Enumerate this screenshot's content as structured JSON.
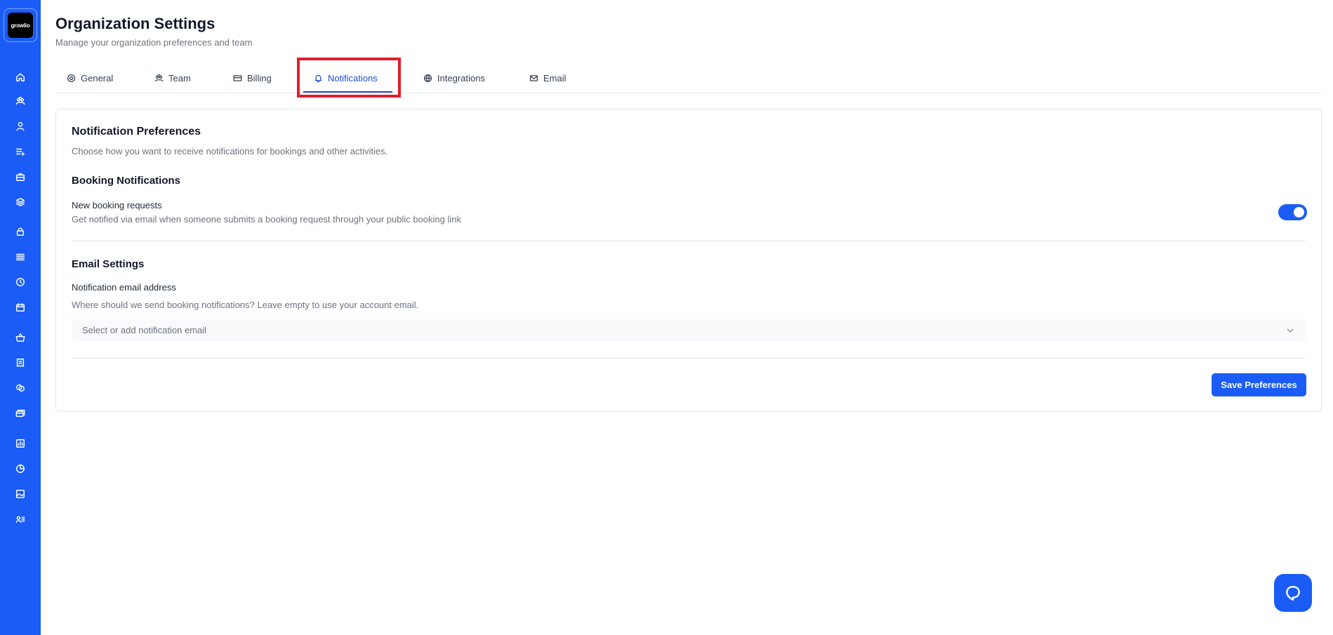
{
  "brand": {
    "logo_text": "growlio",
    "accent": "#1a5cf5",
    "highlight": "#e11d2e"
  },
  "sidebar": {
    "items": [
      {
        "icon": "home-icon"
      },
      {
        "icon": "team-icon"
      },
      {
        "icon": "user-icon"
      },
      {
        "icon": "list-add-icon"
      },
      {
        "icon": "briefcase-icon"
      },
      {
        "icon": "layers-icon"
      },
      {
        "icon": "lock-icon"
      },
      {
        "icon": "menu-lines-icon"
      },
      {
        "icon": "clock-icon"
      },
      {
        "icon": "calendar-icon"
      },
      {
        "icon": "basket-icon"
      },
      {
        "icon": "receipt-icon"
      },
      {
        "icon": "coins-icon"
      },
      {
        "icon": "cards-icon"
      },
      {
        "icon": "chart-icon"
      },
      {
        "icon": "pie-chart-icon"
      },
      {
        "icon": "image-icon"
      },
      {
        "icon": "user-list-icon"
      }
    ]
  },
  "header": {
    "title": "Organization Settings",
    "subtitle": "Manage your organization preferences and team"
  },
  "tabs": [
    {
      "label": "General",
      "icon": "gear-icon"
    },
    {
      "label": "Team",
      "icon": "team-icon"
    },
    {
      "label": "Billing",
      "icon": "credit-card-icon"
    },
    {
      "label": "Notifications",
      "icon": "bell-icon",
      "active": true
    },
    {
      "label": "Integrations",
      "icon": "globe-icon"
    },
    {
      "label": "Email",
      "icon": "mail-icon"
    }
  ],
  "notifications": {
    "title": "Notification Preferences",
    "description": "Choose how you want to receive notifications for bookings and other activities.",
    "booking_section_title": "Booking Notifications",
    "new_booking_label": "New booking requests",
    "new_booking_desc": "Get notified via email when someone submits a booking request through your public booking link",
    "new_booking_enabled": true,
    "email_section_title": "Email Settings",
    "email_field_label": "Notification email address",
    "email_field_help": "Where should we send booking notifications? Leave empty to use your account email.",
    "email_select_placeholder": "Select or add notification email",
    "save_label": "Save Preferences"
  },
  "support": {
    "icon": "chat-bubble-icon"
  }
}
